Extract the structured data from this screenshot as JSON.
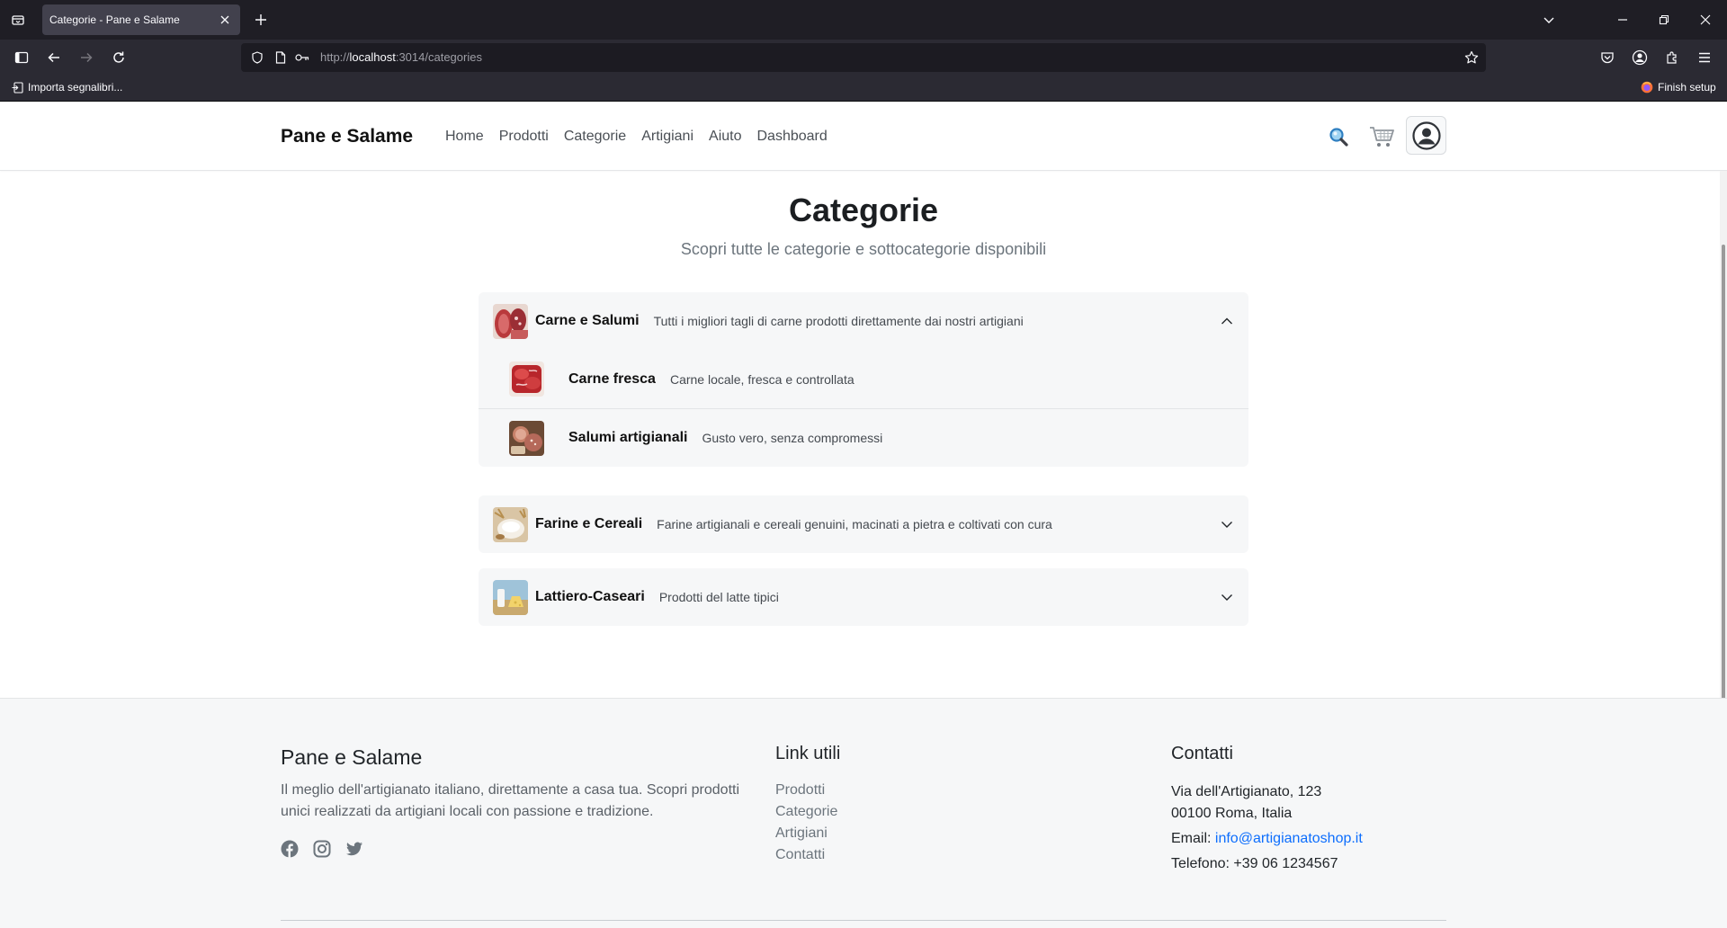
{
  "browser": {
    "tab_title": "Categorie - Pane e Salame",
    "url_prefix": "http://",
    "url_host": "localhost",
    "url_path": ":3014/categories",
    "bookmark_import": "Importa segnalibri...",
    "finish_setup": "Finish setup"
  },
  "site": {
    "brand": "Pane e Salame",
    "nav": [
      "Home",
      "Prodotti",
      "Categorie",
      "Artigiani",
      "Aiuto",
      "Dashboard"
    ]
  },
  "page": {
    "title": "Categorie",
    "subtitle": "Scopri tutte le categorie e sottocategorie disponibili"
  },
  "categories": [
    {
      "name": "Carne e Salumi",
      "description": "Tutti i migliori tagli di carne prodotti direttamente dai nostri artigiani",
      "expanded": true,
      "subcategories": [
        {
          "name": "Carne fresca",
          "description": "Carne locale, fresca e controllata"
        },
        {
          "name": "Salumi artigianali",
          "description": "Gusto vero, senza compromessi"
        }
      ]
    },
    {
      "name": "Farine e Cereali",
      "description": "Farine artigianali e cereali genuini, macinati a pietra e coltivati con cura",
      "expanded": false
    },
    {
      "name": "Lattiero-Caseari",
      "description": "Prodotti del latte tipici",
      "expanded": false
    }
  ],
  "footer": {
    "brand": "Pane e Salame",
    "about": "Il meglio dell'artigianato italiano, direttamente a casa tua. Scopri prodotti unici realizzati da artigiani locali con passione e tradizione.",
    "links_title": "Link utili",
    "links": [
      "Prodotti",
      "Categorie",
      "Artigiani",
      "Contatti"
    ],
    "contact_title": "Contatti",
    "address_line1": "Via dell'Artigianato, 123",
    "address_line2": "00100 Roma, Italia",
    "email_label": "Email: ",
    "email": "info@artigianatoshop.it",
    "phone": "Telefono: +39 06 1234567"
  },
  "colors": {
    "link": "#0d6efd",
    "browser_bg": "#1f1e25"
  },
  "icons": [
    "tab-list-icon",
    "close-icon",
    "plus-icon",
    "back-icon",
    "forward-icon",
    "reload-icon",
    "shield-icon",
    "page-icon",
    "key-icon",
    "star-icon",
    "pocket-icon",
    "account-icon",
    "extensions-icon",
    "menu-icon",
    "search-icon",
    "cart-icon",
    "user-icon",
    "chevron-up-icon",
    "chevron-down-icon",
    "facebook-icon",
    "instagram-icon",
    "twitter-icon"
  ]
}
